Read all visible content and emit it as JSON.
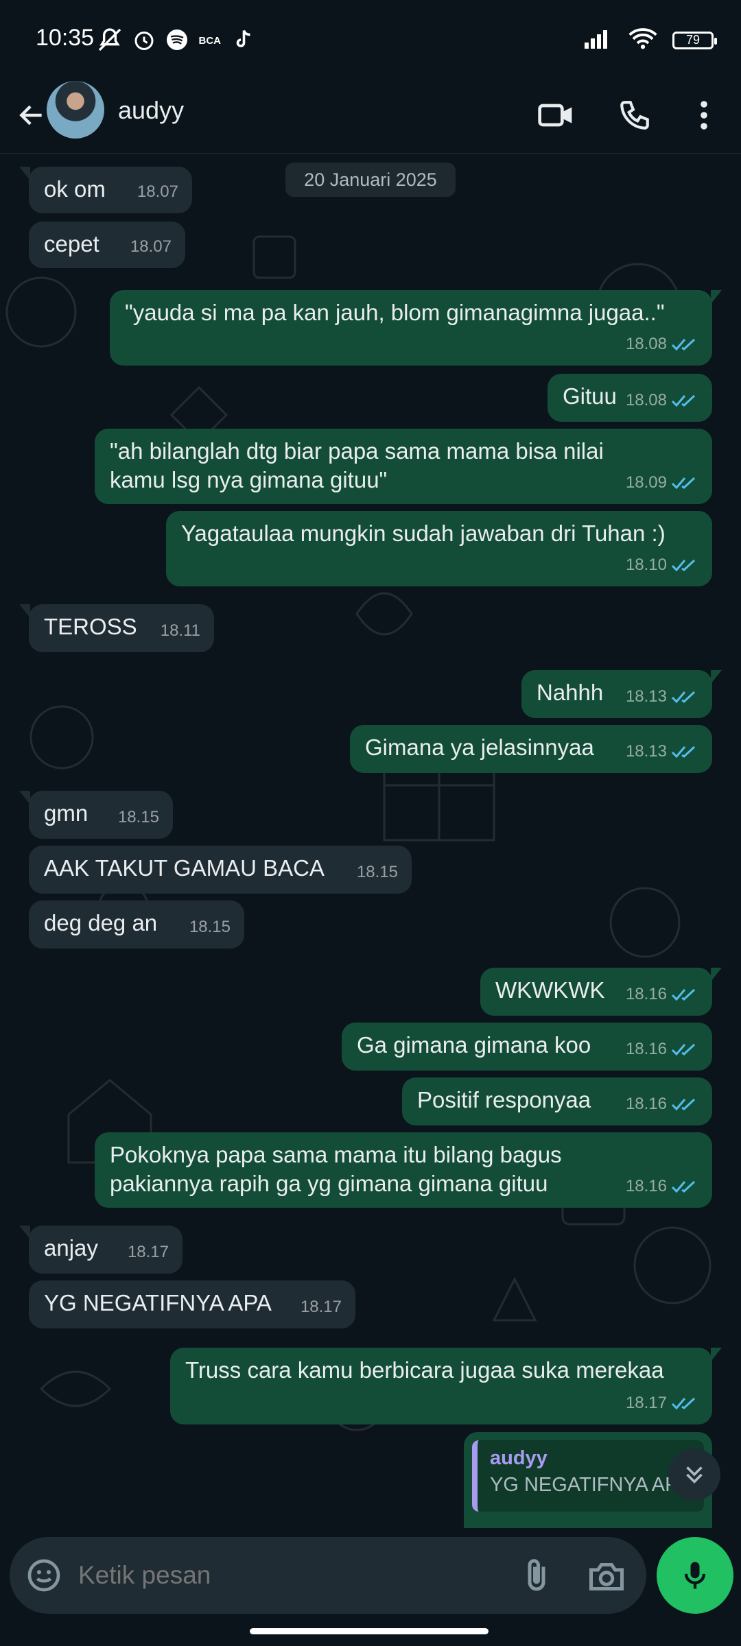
{
  "status_bar": {
    "time": "10:35",
    "battery": "79"
  },
  "header": {
    "contact_name": "audyy"
  },
  "chat": {
    "date_chip": "20 Januari 2025",
    "messages": [
      {
        "dir": "in",
        "text": "ok om",
        "time": "18.07"
      },
      {
        "dir": "in",
        "text": "cepet",
        "time": "18.07"
      },
      {
        "dir": "out",
        "text": "\"yauda si ma pa kan jauh, blom gimanagimna jugaa..\"",
        "time": "18.08"
      },
      {
        "dir": "out",
        "text": "Gituu",
        "time": "18.08"
      },
      {
        "dir": "out",
        "text": "\"ah bilanglah dtg biar papa sama mama bisa nilai kamu lsg nya gimana gituu\"",
        "time": "18.09"
      },
      {
        "dir": "out",
        "text": "Yagataulaa mungkin sudah jawaban dri Tuhan :)",
        "time": "18.10"
      },
      {
        "dir": "in",
        "text": "TEROSS",
        "time": "18.11"
      },
      {
        "dir": "out",
        "text": "Nahhh",
        "time": "18.13"
      },
      {
        "dir": "out",
        "text": "Gimana ya jelasinnyaa",
        "time": "18.13"
      },
      {
        "dir": "in",
        "text": "gmn",
        "time": "18.15"
      },
      {
        "dir": "in",
        "text": "AAK TAKUT GAMAU BACA",
        "time": "18.15"
      },
      {
        "dir": "in",
        "text": "deg deg an",
        "time": "18.15"
      },
      {
        "dir": "out",
        "text": "WKWKWK",
        "time": "18.16"
      },
      {
        "dir": "out",
        "text": "Ga gimana gimana koo",
        "time": "18.16"
      },
      {
        "dir": "out",
        "text": "Positif responyaa",
        "time": "18.16"
      },
      {
        "dir": "out",
        "text": "Pokoknya papa sama mama itu bilang bagus pakiannya rapih ga yg gimana gimana gituu",
        "time": "18.16"
      },
      {
        "dir": "in",
        "text": "anjay",
        "time": "18.17"
      },
      {
        "dir": "in",
        "text": "YG NEGATIFNYA APA",
        "time": "18.17"
      },
      {
        "dir": "out",
        "text": "Truss cara kamu berbicara jugaa suka merekaa",
        "time": "18.17"
      }
    ],
    "reply_preview": {
      "name": "audyy",
      "text": "YG NEGATIFNYA APA"
    }
  },
  "composer": {
    "placeholder": "Ketik pesan"
  },
  "colors": {
    "background": "#0b141a",
    "incoming": "#202c33",
    "outgoing": "#144d37",
    "read_ticks": "#53bdeb",
    "mic_button": "#21c063",
    "reply_accent": "#a89bf0"
  },
  "icons": [
    "mute-icon",
    "alarm-icon",
    "spotify-icon",
    "bca-icon",
    "tiktok-icon",
    "signal-icon",
    "wifi-icon",
    "battery-icon",
    "back-icon",
    "video-call-icon",
    "voice-call-icon",
    "more-icon",
    "double-check-icon",
    "scroll-down-icon",
    "emoji-icon",
    "attach-icon",
    "camera-icon",
    "mic-icon"
  ]
}
